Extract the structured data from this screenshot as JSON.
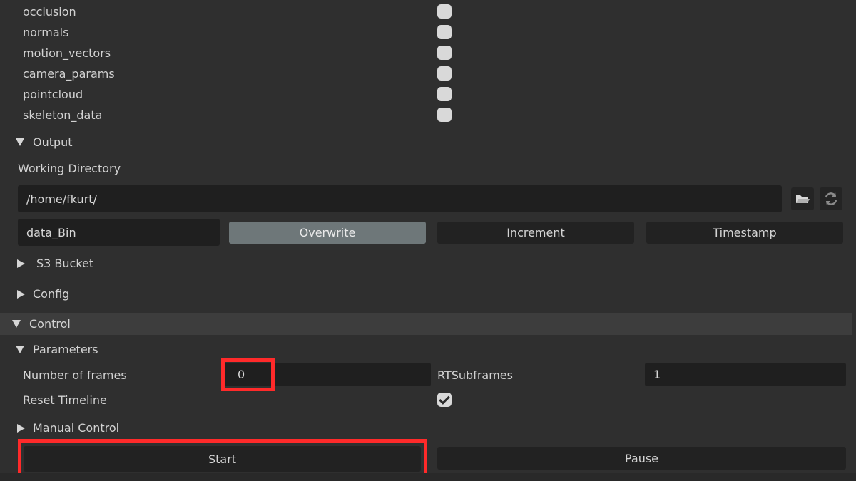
{
  "outputs": [
    {
      "label": "occlusion",
      "checked": false
    },
    {
      "label": "normals",
      "checked": false
    },
    {
      "label": "motion_vectors",
      "checked": false
    },
    {
      "label": "camera_params",
      "checked": false
    },
    {
      "label": "pointcloud",
      "checked": false
    },
    {
      "label": "skeleton_data",
      "checked": false
    }
  ],
  "output_section": {
    "title": "Output",
    "working_dir_label": "Working Directory",
    "working_dir_value": "/home/fkurt/",
    "folder_name_value": "data_Bin",
    "overwrite_label": "Overwrite",
    "increment_label": "Increment",
    "timestamp_label": "Timestamp",
    "s3_label": "S3 Bucket",
    "config_label": "Config"
  },
  "control": {
    "title": "Control",
    "parameters_title": "Parameters",
    "num_frames_label": "Number of frames",
    "num_frames_value": "0",
    "rt_subframes_label": "RTSubframes",
    "rt_subframes_value": "1",
    "reset_timeline_label": "Reset Timeline",
    "reset_timeline_checked": true,
    "manual_control_label": "Manual Control",
    "start_label": "Start",
    "pause_label": "Pause"
  },
  "colors": {
    "highlight": "#ff2a2a",
    "active_button": "#6e7779"
  }
}
